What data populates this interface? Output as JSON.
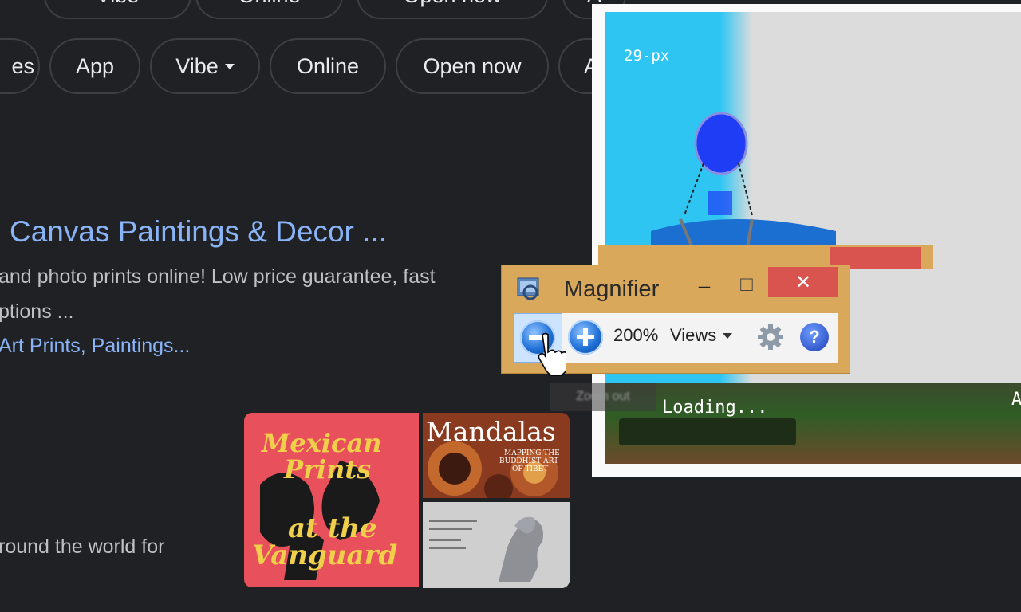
{
  "chips_top": [
    {
      "label": "Vibe"
    },
    {
      "label": "Online"
    },
    {
      "label": "Open now"
    },
    {
      "label": "A"
    }
  ],
  "chips": [
    {
      "label": "es"
    },
    {
      "label": "App"
    },
    {
      "label": "Vibe"
    },
    {
      "label": "Online"
    },
    {
      "label": "Open now"
    },
    {
      "label": "A"
    }
  ],
  "result": {
    "title": "Canvas Paintings & Decor ...",
    "snippet_line1": "and photo prints online! Low price guarantee, fast",
    "snippet_line2": "ptions ...",
    "sitelinks": "Art Prints, Paintings...",
    "snippet_bottom": "round the world for"
  },
  "images": {
    "poster1_line1": "Mexican",
    "poster1_line2": "Prints",
    "poster1_line3": "at the",
    "poster1_line4": "Vanguard",
    "mandala_title": "Mandalas",
    "mandala_sub1": "MAPPING THE",
    "mandala_sub2": "BUDDHIST ART",
    "mandala_sub3": "OF TIBET"
  },
  "game": {
    "score_text": "29-px",
    "loading_text": "Loading...",
    "edge_text": "A"
  },
  "magnifier": {
    "title": "Magnifier",
    "minimize": "–",
    "maximize": "□",
    "close": "✕",
    "zoom_level": "200%",
    "views_label": "Views",
    "tooltip": "Zoom out"
  },
  "icons": {
    "zoom_out": "minus-icon",
    "zoom_in": "plus-icon",
    "settings": "gear-icon",
    "help": "help-icon",
    "app": "magnifier-app-icon"
  },
  "colors": {
    "page_bg": "#202124",
    "link": "#8ab4f8",
    "chip_border": "#3c4043",
    "magnifier_frame": "#d9a85a",
    "close_red": "#d9534f"
  }
}
